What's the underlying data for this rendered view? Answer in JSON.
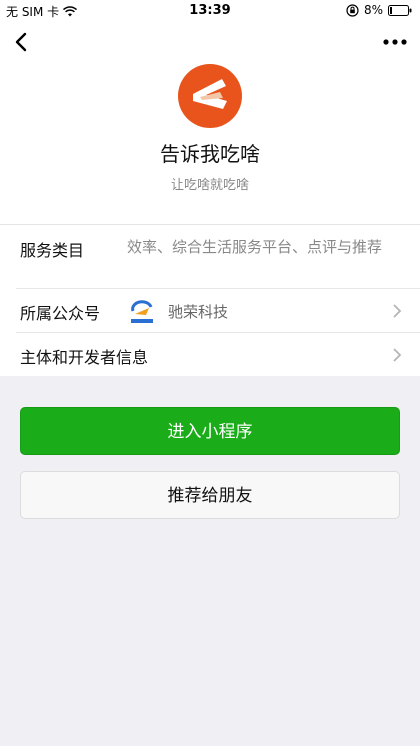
{
  "status_bar": {
    "carrier": "无 SIM 卡",
    "time": "13:39",
    "battery": "8%"
  },
  "profile": {
    "name": "告诉我吃啥",
    "slogan": "让吃啥就吃啥"
  },
  "info": {
    "category_label": "服务类目",
    "category_value": "效率、综合生活服务平台、点评与推荐",
    "account_label": "所属公众号",
    "account_name": "驰荣科技",
    "developer_label": "主体和开发者信息"
  },
  "actions": {
    "enter_label": "进入小程序",
    "share_label": "推荐给朋友"
  },
  "colors": {
    "primary_green": "#1aad19",
    "avatar_orange": "#e8541c"
  }
}
